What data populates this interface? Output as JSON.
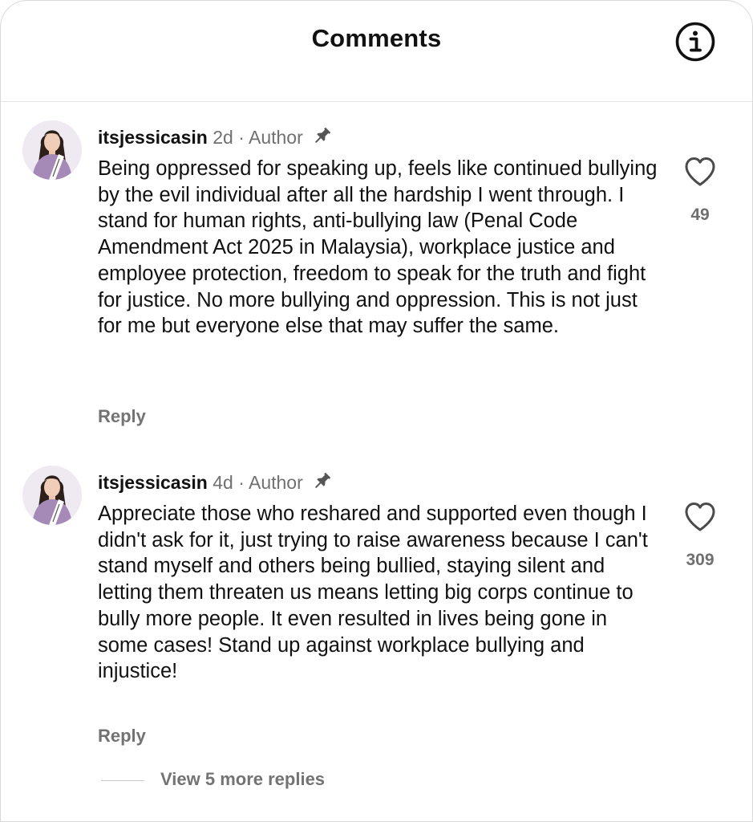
{
  "header": {
    "title": "Comments",
    "info_icon": "info-circle-icon"
  },
  "comments": [
    {
      "username": "itsjessicasin",
      "time": "2d",
      "separator": "·",
      "role": "Author",
      "pinned_icon": "pin-icon",
      "body": "Being oppressed for speaking up, feels like continued bullying by the evil individual after all the hardship I went through. I stand for human rights, anti-bullying law (Penal Code Amendment Act 2025 in Malaysia), workplace justice and employee protection, freedom to speak for the truth and fight for justice. No more bullying and oppression. This is not just for me but everyone else that may suffer the same.",
      "likes": "49",
      "reply_label": "Reply"
    },
    {
      "username": "itsjessicasin",
      "time": "4d",
      "separator": "·",
      "role": "Author",
      "pinned_icon": "pin-icon",
      "body": "Appreciate those who reshared and supported even though I didn't ask for it, just trying to raise awareness because I can't stand myself and others being bullied, staying silent and letting them threaten us means letting big corps continue to bully more people. It even resulted in lives being gone in some cases! Stand up against workplace bullying and injustice!",
      "likes": "309",
      "reply_label": "Reply"
    }
  ],
  "view_more_replies": "View 5 more replies",
  "colors": {
    "text": "#111111",
    "muted": "#737373",
    "avatar_sash": "#ffffff",
    "avatar_dress": "#a58ab8"
  }
}
